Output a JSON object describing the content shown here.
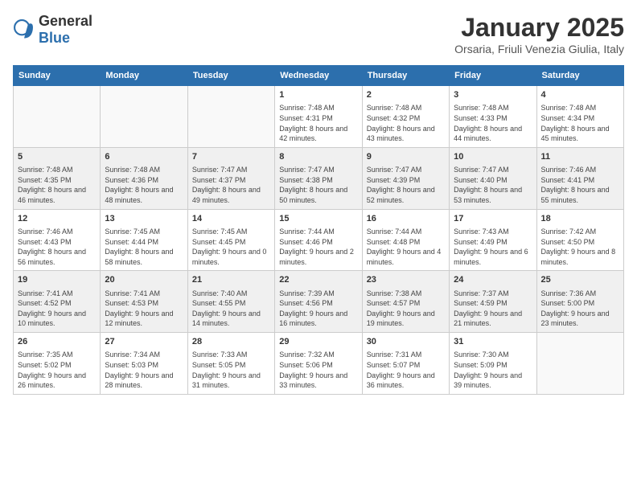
{
  "logo": {
    "general": "General",
    "blue": "Blue"
  },
  "title": "January 2025",
  "subtitle": "Orsaria, Friuli Venezia Giulia, Italy",
  "weekdays": [
    "Sunday",
    "Monday",
    "Tuesday",
    "Wednesday",
    "Thursday",
    "Friday",
    "Saturday"
  ],
  "weeks": [
    [
      {
        "day": "",
        "info": ""
      },
      {
        "day": "",
        "info": ""
      },
      {
        "day": "",
        "info": ""
      },
      {
        "day": "1",
        "info": "Sunrise: 7:48 AM\nSunset: 4:31 PM\nDaylight: 8 hours and 42 minutes."
      },
      {
        "day": "2",
        "info": "Sunrise: 7:48 AM\nSunset: 4:32 PM\nDaylight: 8 hours and 43 minutes."
      },
      {
        "day": "3",
        "info": "Sunrise: 7:48 AM\nSunset: 4:33 PM\nDaylight: 8 hours and 44 minutes."
      },
      {
        "day": "4",
        "info": "Sunrise: 7:48 AM\nSunset: 4:34 PM\nDaylight: 8 hours and 45 minutes."
      }
    ],
    [
      {
        "day": "5",
        "info": "Sunrise: 7:48 AM\nSunset: 4:35 PM\nDaylight: 8 hours and 46 minutes."
      },
      {
        "day": "6",
        "info": "Sunrise: 7:48 AM\nSunset: 4:36 PM\nDaylight: 8 hours and 48 minutes."
      },
      {
        "day": "7",
        "info": "Sunrise: 7:47 AM\nSunset: 4:37 PM\nDaylight: 8 hours and 49 minutes."
      },
      {
        "day": "8",
        "info": "Sunrise: 7:47 AM\nSunset: 4:38 PM\nDaylight: 8 hours and 50 minutes."
      },
      {
        "day": "9",
        "info": "Sunrise: 7:47 AM\nSunset: 4:39 PM\nDaylight: 8 hours and 52 minutes."
      },
      {
        "day": "10",
        "info": "Sunrise: 7:47 AM\nSunset: 4:40 PM\nDaylight: 8 hours and 53 minutes."
      },
      {
        "day": "11",
        "info": "Sunrise: 7:46 AM\nSunset: 4:41 PM\nDaylight: 8 hours and 55 minutes."
      }
    ],
    [
      {
        "day": "12",
        "info": "Sunrise: 7:46 AM\nSunset: 4:43 PM\nDaylight: 8 hours and 56 minutes."
      },
      {
        "day": "13",
        "info": "Sunrise: 7:45 AM\nSunset: 4:44 PM\nDaylight: 8 hours and 58 minutes."
      },
      {
        "day": "14",
        "info": "Sunrise: 7:45 AM\nSunset: 4:45 PM\nDaylight: 9 hours and 0 minutes."
      },
      {
        "day": "15",
        "info": "Sunrise: 7:44 AM\nSunset: 4:46 PM\nDaylight: 9 hours and 2 minutes."
      },
      {
        "day": "16",
        "info": "Sunrise: 7:44 AM\nSunset: 4:48 PM\nDaylight: 9 hours and 4 minutes."
      },
      {
        "day": "17",
        "info": "Sunrise: 7:43 AM\nSunset: 4:49 PM\nDaylight: 9 hours and 6 minutes."
      },
      {
        "day": "18",
        "info": "Sunrise: 7:42 AM\nSunset: 4:50 PM\nDaylight: 9 hours and 8 minutes."
      }
    ],
    [
      {
        "day": "19",
        "info": "Sunrise: 7:41 AM\nSunset: 4:52 PM\nDaylight: 9 hours and 10 minutes."
      },
      {
        "day": "20",
        "info": "Sunrise: 7:41 AM\nSunset: 4:53 PM\nDaylight: 9 hours and 12 minutes."
      },
      {
        "day": "21",
        "info": "Sunrise: 7:40 AM\nSunset: 4:55 PM\nDaylight: 9 hours and 14 minutes."
      },
      {
        "day": "22",
        "info": "Sunrise: 7:39 AM\nSunset: 4:56 PM\nDaylight: 9 hours and 16 minutes."
      },
      {
        "day": "23",
        "info": "Sunrise: 7:38 AM\nSunset: 4:57 PM\nDaylight: 9 hours and 19 minutes."
      },
      {
        "day": "24",
        "info": "Sunrise: 7:37 AM\nSunset: 4:59 PM\nDaylight: 9 hours and 21 minutes."
      },
      {
        "day": "25",
        "info": "Sunrise: 7:36 AM\nSunset: 5:00 PM\nDaylight: 9 hours and 23 minutes."
      }
    ],
    [
      {
        "day": "26",
        "info": "Sunrise: 7:35 AM\nSunset: 5:02 PM\nDaylight: 9 hours and 26 minutes."
      },
      {
        "day": "27",
        "info": "Sunrise: 7:34 AM\nSunset: 5:03 PM\nDaylight: 9 hours and 28 minutes."
      },
      {
        "day": "28",
        "info": "Sunrise: 7:33 AM\nSunset: 5:05 PM\nDaylight: 9 hours and 31 minutes."
      },
      {
        "day": "29",
        "info": "Sunrise: 7:32 AM\nSunset: 5:06 PM\nDaylight: 9 hours and 33 minutes."
      },
      {
        "day": "30",
        "info": "Sunrise: 7:31 AM\nSunset: 5:07 PM\nDaylight: 9 hours and 36 minutes."
      },
      {
        "day": "31",
        "info": "Sunrise: 7:30 AM\nSunset: 5:09 PM\nDaylight: 9 hours and 39 minutes."
      },
      {
        "day": "",
        "info": ""
      }
    ]
  ]
}
